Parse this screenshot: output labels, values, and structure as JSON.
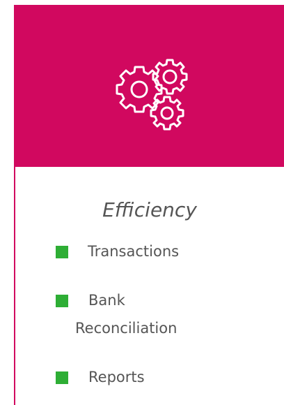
{
  "brand_color": "#d1085f",
  "bullet_color": "#2eae35",
  "header": {
    "icon": "gears-icon"
  },
  "title": "Efficiency",
  "items": [
    {
      "label": "Transactions"
    },
    {
      "label_line1": "Bank",
      "label_line2": "Reconciliation"
    },
    {
      "label": "Reports"
    }
  ]
}
